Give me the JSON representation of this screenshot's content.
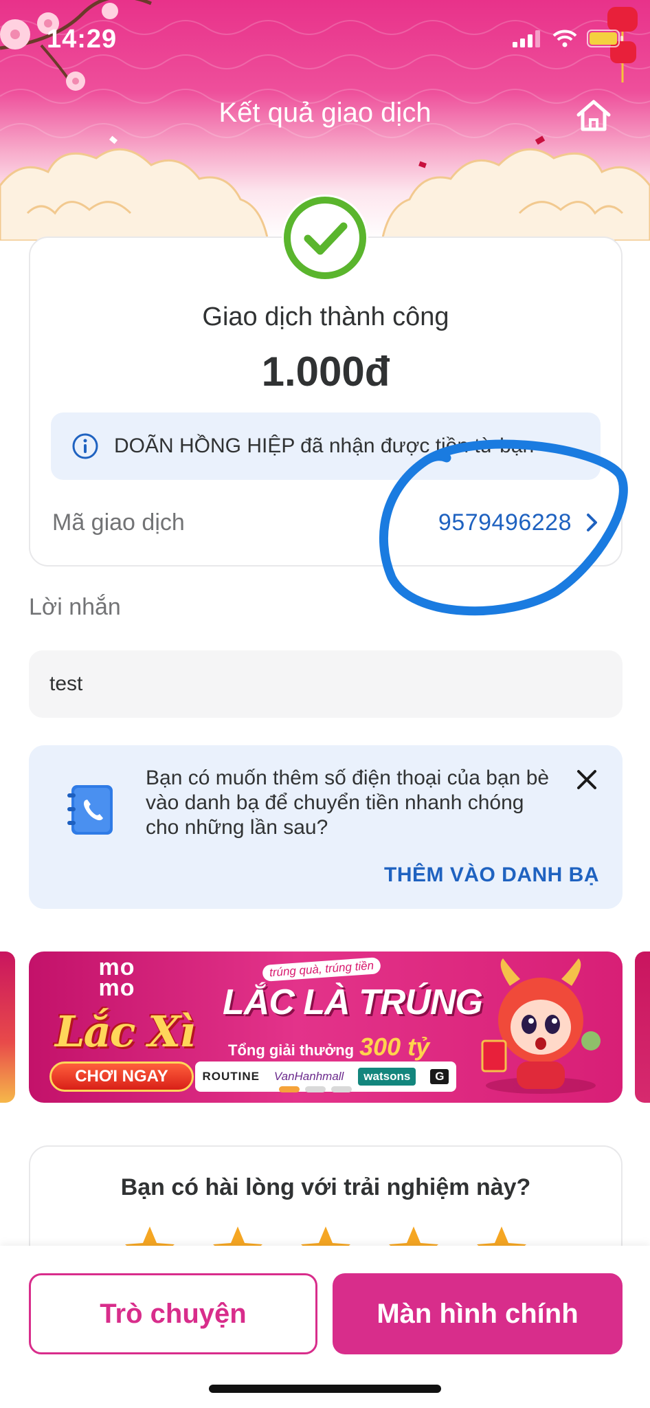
{
  "status_bar": {
    "time": "14:29"
  },
  "header": {
    "title": "Kết quả giao dịch"
  },
  "result": {
    "status": "Giao dịch thành công",
    "amount": "1.000đ",
    "info_message": "DOÃN HỒNG HIỆP đã nhận được tiền từ bạn",
    "transaction_label": "Mã giao dịch",
    "transaction_id": "9579496228"
  },
  "message": {
    "label": "Lời nhắn",
    "value": "test"
  },
  "contact_prompt": {
    "text": "Bạn có muốn thêm số điện thoại của bạn bè vào danh bạ để chuyển tiền nhanh chóng cho những lần sau?",
    "action": "THÊM VÀO DANH BẠ"
  },
  "banner": {
    "logo_line1": "mo",
    "logo_line2": "mo",
    "title": "Lắc Xì",
    "play_button": "CHƠI NGAY",
    "tagline": "trúng quà, trúng tiền",
    "headline": "LẮC LÀ TRÚNG",
    "prize_label": "Tổng giải thưởng",
    "prize_value": "300 tỷ",
    "brands": [
      "ROUTINE",
      "VanHanhmall",
      "watsons",
      "G"
    ],
    "active_slide": 1,
    "slide_count": 3
  },
  "rating": {
    "question": "Bạn có hài lòng với trải nghiệm này?",
    "star_count": 5
  },
  "actions": {
    "chat": "Trò chuyện",
    "home": "Màn hình chính"
  },
  "colors": {
    "brand_pink": "#d82d8b",
    "link_blue": "#1f62c0",
    "success_green": "#5ab52d",
    "info_bg": "#eaf1fc",
    "annotation_blue": "#1a7be0"
  }
}
